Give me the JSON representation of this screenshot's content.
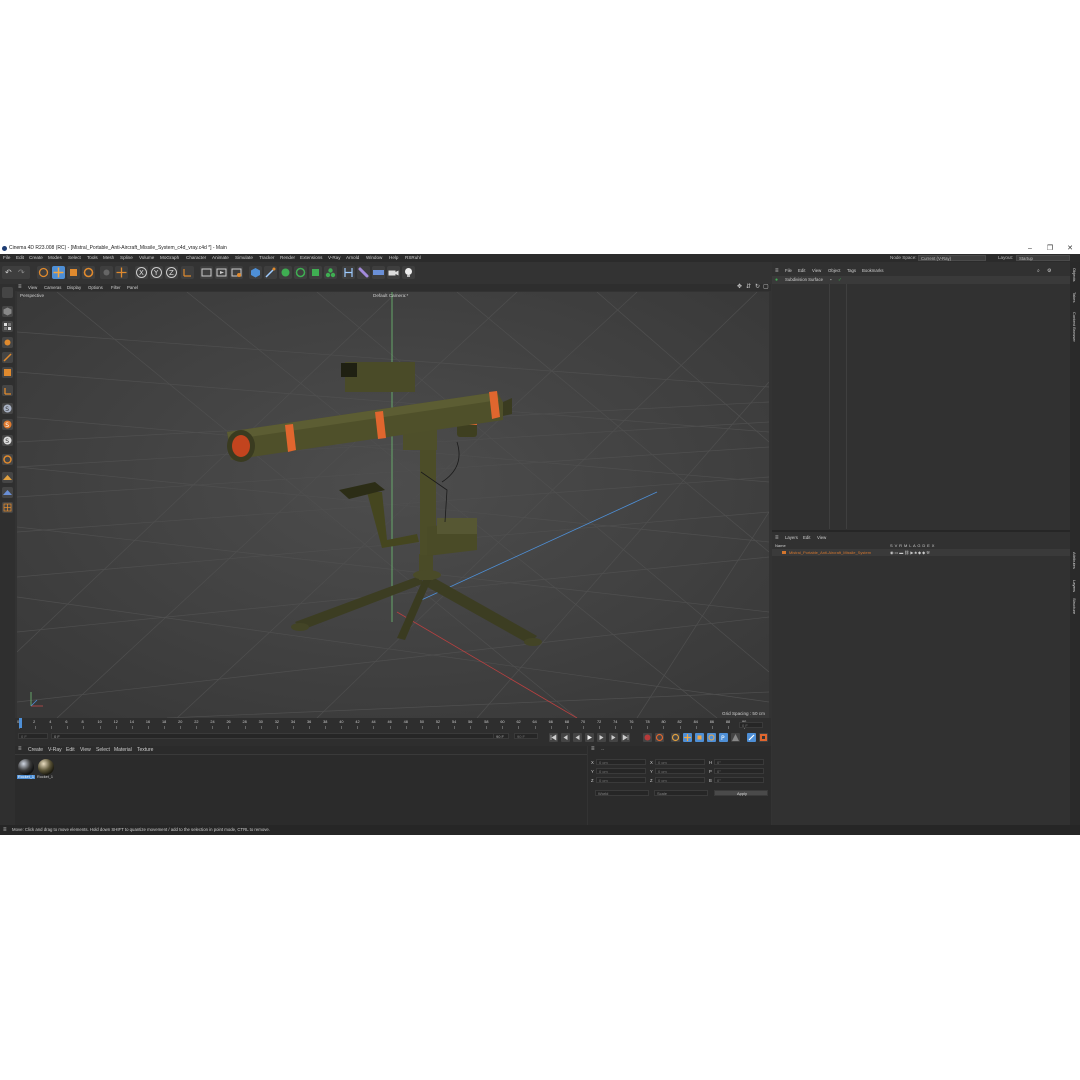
{
  "window": {
    "title": "Cinema 4D R23.008 (RC) - [Mistral_Portable_Anti-Aircraft_Missile_System_c4d_vray.c4d *] - Main",
    "minimize": "–",
    "maximize": "❐",
    "close": "✕"
  },
  "menu": {
    "items": [
      "File",
      "Edit",
      "Create",
      "Modes",
      "Select",
      "Tools",
      "Mesh",
      "Spline",
      "Volume",
      "MoGraph",
      "Character",
      "Animate",
      "Simulate",
      "Tracker",
      "Render",
      "Extensions",
      "V-Ray",
      "Arnold",
      "Window",
      "Help",
      "RSRuhl"
    ],
    "node_space_label": "Node Space:",
    "node_space_value": "Current (V-Ray)",
    "layout_label": "Layout:",
    "layout_value": "Startup"
  },
  "toolbar": {
    "axis_x": "X",
    "axis_y": "Y",
    "axis_z": "Z"
  },
  "viewport": {
    "menu": [
      "View",
      "Cameras",
      "Display",
      "Options",
      "Filter",
      "Panel"
    ],
    "view_name": "Perspective",
    "camera_name": "Default Camera:*",
    "grid_spacing": "Grid Spacing : 50 cm"
  },
  "timeline": {
    "ticks": [
      "0",
      "2",
      "4",
      "6",
      "8",
      "10",
      "12",
      "14",
      "16",
      "18",
      "20",
      "22",
      "24",
      "26",
      "28",
      "30",
      "32",
      "34",
      "36",
      "38",
      "40",
      "42",
      "44",
      "46",
      "48",
      "50",
      "52",
      "54",
      "56",
      "58",
      "60",
      "62",
      "64",
      "66",
      "68",
      "70",
      "72",
      "74",
      "76",
      "78",
      "80",
      "82",
      "84",
      "86",
      "88",
      "90"
    ],
    "current_frame": "0 F",
    "start_field": "0 F",
    "slider_value": "0 F",
    "end_field": "90 F",
    "end_field2": "90 F",
    "right_frame": "0 F"
  },
  "materials": {
    "menu": [
      "Create",
      "V-Ray",
      "Edit",
      "View",
      "Select",
      "Material",
      "Texture"
    ],
    "items": [
      {
        "name": "Rocket_1",
        "selected": true
      },
      {
        "name": "Rocket_1",
        "selected": false
      }
    ]
  },
  "coordinates": {
    "header": "--",
    "rows": [
      {
        "a": "X",
        "a_val": "0 cm",
        "b": "X",
        "b_val": "0 cm",
        "c": "H",
        "c_val": "0°"
      },
      {
        "a": "Y",
        "a_val": "0 cm",
        "b": "Y",
        "b_val": "0 cm",
        "c": "P",
        "c_val": "0°"
      },
      {
        "a": "Z",
        "a_val": "0 cm",
        "b": "Z",
        "b_val": "0 cm",
        "c": "B",
        "c_val": "0°"
      }
    ],
    "mode": "World",
    "size_mode": "Scale",
    "apply": "Apply"
  },
  "objects": {
    "menu": [
      "File",
      "Edit",
      "View",
      "Object",
      "Tags",
      "Bookmarks"
    ],
    "items": [
      {
        "name": "Subdivision Surface"
      }
    ]
  },
  "layers": {
    "menu": [
      "Layers",
      "Edit",
      "View"
    ],
    "name_header": "Name",
    "flags": "S  V  R  M  L  A  G  D  E  X",
    "items": [
      {
        "name": "Mistral_Portable_Anti-Aircraft_Missile_System",
        "color": "#d4762e"
      }
    ]
  },
  "right_tabs": [
    "Objects",
    "Takes",
    "Content Browser",
    "Attributes",
    "Layers",
    "Structure"
  ],
  "status": {
    "text": "Move: Click and drag to move elements. Hold down SHIFT to quantize movement / add to the selection in point mode, CTRL to remove."
  },
  "colors": {
    "accent": "#4e8fd6",
    "orange": "#e0662e",
    "olive": "#4a4a25",
    "grid": "#4c4c4c"
  }
}
